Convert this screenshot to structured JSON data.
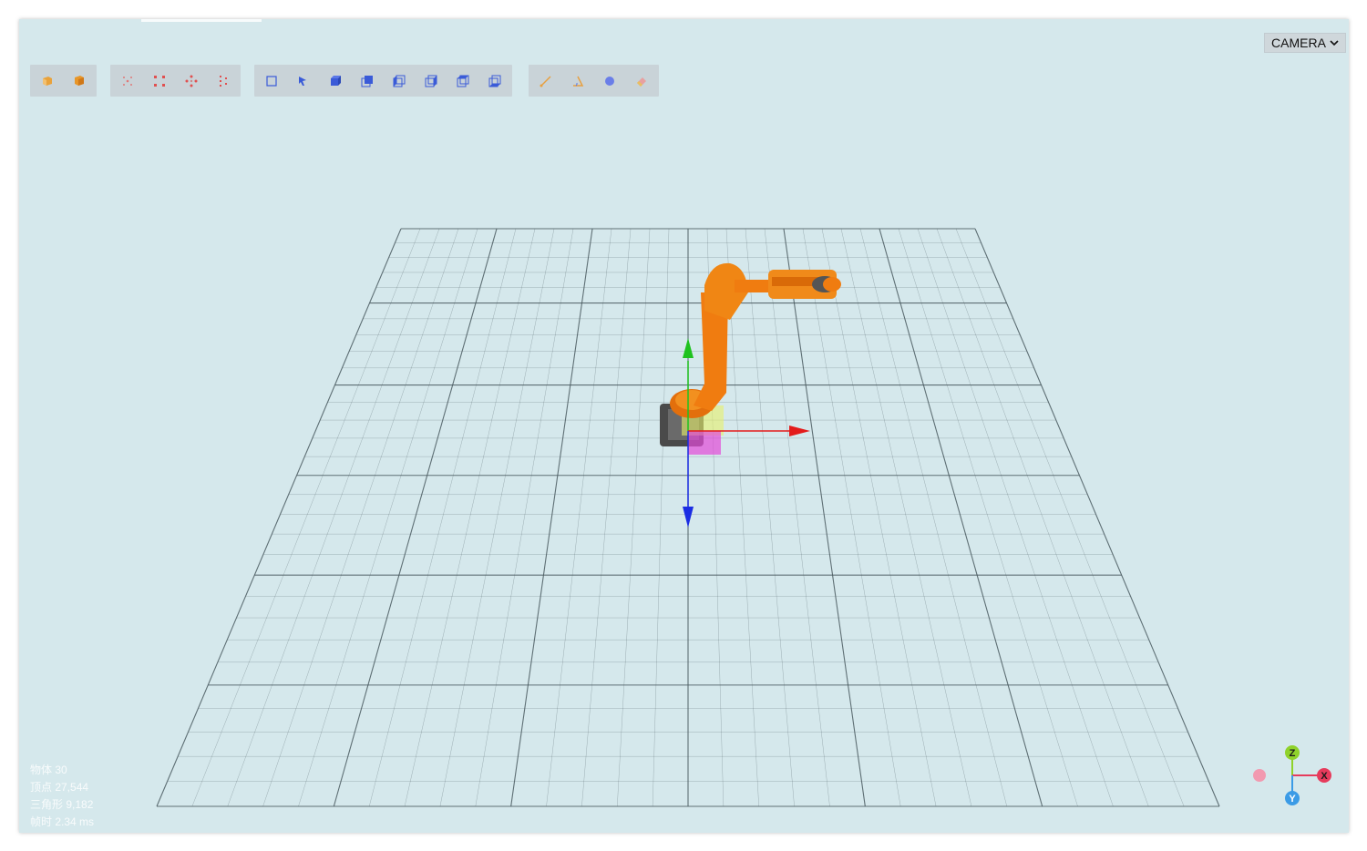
{
  "viewport": {
    "camera_label": "CAMERA",
    "background_color": "#d5e8ec",
    "grid_color": "#4a5a60",
    "robot_color": "#f07c10"
  },
  "toolbar": {
    "groups": [
      {
        "name": "view-mode",
        "icons": [
          "solid-cube-icon",
          "shaded-cube-icon"
        ]
      },
      {
        "name": "snap",
        "icons": [
          "snap-center-icon",
          "snap-corners-icon",
          "snap-move-icon",
          "snap-points-icon"
        ]
      },
      {
        "name": "views",
        "icons": [
          "frame-view-icon",
          "select-tool-icon",
          "front-view-icon",
          "back-view-icon",
          "left-view-icon",
          "right-view-icon",
          "top-view-icon",
          "bottom-view-icon"
        ]
      },
      {
        "name": "measure",
        "icons": [
          "measure-line-icon",
          "measure-angle-icon",
          "point-marker-icon",
          "eraser-icon"
        ]
      }
    ]
  },
  "stats": {
    "objects": "物体 30",
    "vertices": "顶点 27,544",
    "triangles": "三角形 9,182",
    "frame_time": "帧时 2.34 ms"
  },
  "axes": {
    "z_label": "Z",
    "x_label": "X",
    "y_label": "Y",
    "z_color": "#8fd22b",
    "x_color": "#e63b5c",
    "y_color": "#3b9be6"
  }
}
